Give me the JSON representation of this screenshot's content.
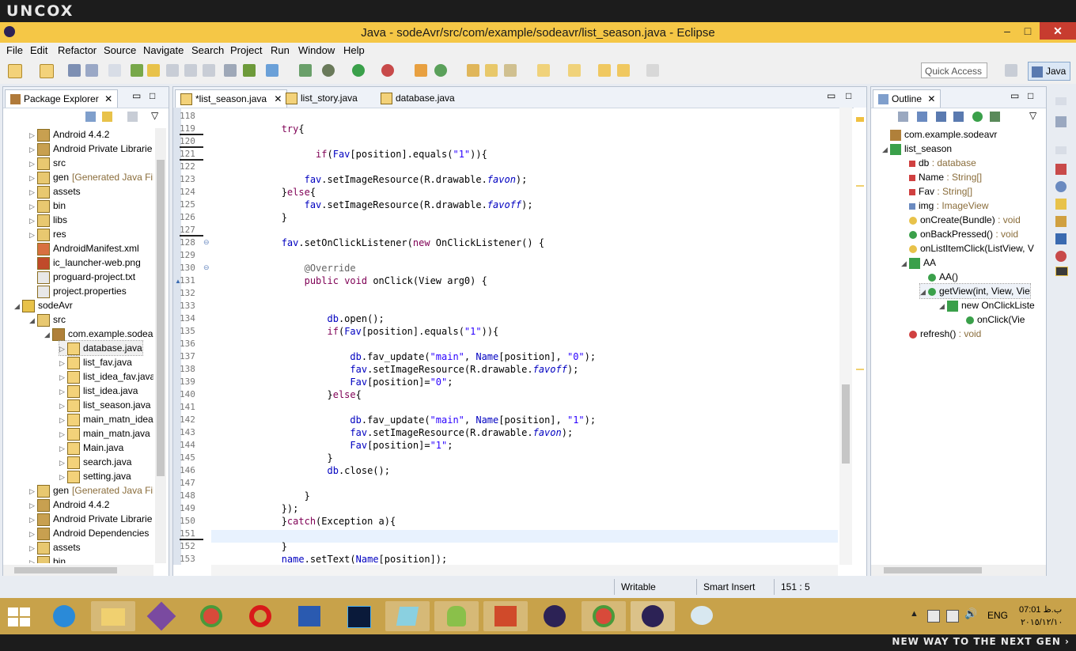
{
  "brand": "UNCOX",
  "slogan": "NEW WAY TO THE NEXT GEN ›",
  "window": {
    "title": "Java - sodeAvr/src/com/example/sodeavr/list_season.java - Eclipse",
    "min": "–",
    "max": "□",
    "close": "✕"
  },
  "menu": [
    "File",
    "Edit",
    "Refactor",
    "Source",
    "Navigate",
    "Search",
    "Project",
    "Run",
    "Window",
    "Help"
  ],
  "toolbar": {
    "quick_access": "Quick Access",
    "perspective": "Java"
  },
  "package_explorer": {
    "tab": "Package Explorer",
    "items": [
      {
        "label": "Android 4.4.2",
        "extra": "",
        "depth": 1,
        "icon": "library-icon"
      },
      {
        "label": "Android Private Librarie",
        "extra": "",
        "depth": 1,
        "icon": "library-icon"
      },
      {
        "label": "src",
        "extra": "",
        "depth": 1,
        "icon": "folder-icon"
      },
      {
        "label": "gen",
        "extra": "[Generated Java File",
        "depth": 1,
        "icon": "folder-icon"
      },
      {
        "label": "assets",
        "extra": "",
        "depth": 1,
        "icon": "folder-icon"
      },
      {
        "label": "bin",
        "extra": "",
        "depth": 1,
        "icon": "folder-icon"
      },
      {
        "label": "libs",
        "extra": "",
        "depth": 1,
        "icon": "folder-icon"
      },
      {
        "label": "res",
        "extra": "",
        "depth": 1,
        "icon": "folder-icon"
      },
      {
        "label": "AndroidManifest.xml",
        "extra": "",
        "depth": 1,
        "icon": "xml-file-icon"
      },
      {
        "label": "ic_launcher-web.png",
        "extra": "",
        "depth": 1,
        "icon": "image-file-icon"
      },
      {
        "label": "proguard-project.txt",
        "extra": "",
        "depth": 1,
        "icon": "text-file-icon"
      },
      {
        "label": "project.properties",
        "extra": "",
        "depth": 1,
        "icon": "text-file-icon"
      },
      {
        "label": "sodeAvr",
        "extra": "",
        "depth": 0,
        "icon": "project-icon"
      },
      {
        "label": "src",
        "extra": "",
        "depth": 1,
        "icon": "folder-icon"
      },
      {
        "label": "com.example.sodea",
        "extra": "",
        "depth": 2,
        "icon": "package-icon"
      },
      {
        "label": "database.java",
        "extra": "",
        "depth": 3,
        "icon": "java-file-icon"
      },
      {
        "label": "list_fav.java",
        "extra": "",
        "depth": 3,
        "icon": "java-file-icon"
      },
      {
        "label": "list_idea_fav.java",
        "extra": "",
        "depth": 3,
        "icon": "java-file-icon"
      },
      {
        "label": "list_idea.java",
        "extra": "",
        "depth": 3,
        "icon": "java-file-icon"
      },
      {
        "label": "list_season.java",
        "extra": "",
        "depth": 3,
        "icon": "java-file-icon"
      },
      {
        "label": "main_matn_idea",
        "extra": "",
        "depth": 3,
        "icon": "java-file-icon"
      },
      {
        "label": "main_matn.java",
        "extra": "",
        "depth": 3,
        "icon": "java-file-icon"
      },
      {
        "label": "Main.java",
        "extra": "",
        "depth": 3,
        "icon": "java-file-icon"
      },
      {
        "label": "search.java",
        "extra": "",
        "depth": 3,
        "icon": "java-file-icon"
      },
      {
        "label": "setting.java",
        "extra": "",
        "depth": 3,
        "icon": "java-file-icon"
      },
      {
        "label": "gen",
        "extra": "[Generated Java File",
        "depth": 1,
        "icon": "folder-icon"
      },
      {
        "label": "Android 4.4.2",
        "extra": "",
        "depth": 1,
        "icon": "library-icon"
      },
      {
        "label": "Android Private Librarie",
        "extra": "",
        "depth": 1,
        "icon": "library-icon"
      },
      {
        "label": "Android Dependencies",
        "extra": "",
        "depth": 1,
        "icon": "library-icon"
      },
      {
        "label": "assets",
        "extra": "",
        "depth": 1,
        "icon": "folder-icon"
      },
      {
        "label": "bin",
        "extra": "",
        "depth": 1,
        "icon": "folder-icon"
      }
    ]
  },
  "editor": {
    "tabs": [
      {
        "label": "*list_season.java",
        "active": true
      },
      {
        "label": "list_story.java",
        "active": false
      },
      {
        "label": "database.java",
        "active": false
      }
    ],
    "lines": [
      {
        "n": "118",
        "t": ""
      },
      {
        "n": "119",
        "t": "            try{"
      },
      {
        "n": "120",
        "t": ""
      },
      {
        "n": "121",
        "t": "                  if(Fav[position].equals(\"1\")){"
      },
      {
        "n": "122",
        "t": ""
      },
      {
        "n": "123",
        "t": "                fav.setImageResource(R.drawable.favon);"
      },
      {
        "n": "124",
        "t": "            }else{"
      },
      {
        "n": "125",
        "t": "                fav.setImageResource(R.drawable.favoff);"
      },
      {
        "n": "126",
        "t": "            }"
      },
      {
        "n": "127",
        "t": ""
      },
      {
        "n": "128",
        "t": "            fav.setOnClickListener(new OnClickListener() {"
      },
      {
        "n": "129",
        "t": ""
      },
      {
        "n": "130",
        "t": "                @Override"
      },
      {
        "n": "131",
        "t": "                public void onClick(View arg0) {"
      },
      {
        "n": "132",
        "t": ""
      },
      {
        "n": "133",
        "t": ""
      },
      {
        "n": "134",
        "t": "                    db.open();"
      },
      {
        "n": "135",
        "t": "                    if(Fav[position].equals(\"1\")){"
      },
      {
        "n": "136",
        "t": ""
      },
      {
        "n": "137",
        "t": "                        db.fav_update(\"main\", Name[position], \"0\");"
      },
      {
        "n": "138",
        "t": "                        fav.setImageResource(R.drawable.favoff);"
      },
      {
        "n": "139",
        "t": "                        Fav[position]=\"0\";"
      },
      {
        "n": "140",
        "t": "                    }else{"
      },
      {
        "n": "141",
        "t": ""
      },
      {
        "n": "142",
        "t": "                        db.fav_update(\"main\", Name[position], \"1\");"
      },
      {
        "n": "143",
        "t": "                        fav.setImageResource(R.drawable.favon);"
      },
      {
        "n": "144",
        "t": "                        Fav[position]=\"1\";"
      },
      {
        "n": "145",
        "t": "                    }"
      },
      {
        "n": "146",
        "t": "                    db.close();"
      },
      {
        "n": "147",
        "t": ""
      },
      {
        "n": "148",
        "t": "                }"
      },
      {
        "n": "149",
        "t": "            });"
      },
      {
        "n": "150",
        "t": "            }catch(Exception a){"
      },
      {
        "n": "151",
        "t": ""
      },
      {
        "n": "152",
        "t": "            }"
      },
      {
        "n": "153",
        "t": "            name.setText(Name[position]);"
      }
    ]
  },
  "outline": {
    "tab": "Outline",
    "items": [
      {
        "label": "com.example.sodeavr",
        "type": "",
        "depth": 0,
        "icon": "package-icon"
      },
      {
        "label": "list_season",
        "type": "",
        "depth": 0,
        "icon": "class-icon"
      },
      {
        "label": "db",
        "type": " : database",
        "depth": 1,
        "icon": "private-field-icon"
      },
      {
        "label": "Name",
        "type": " : String[]",
        "depth": 1,
        "icon": "private-field-icon"
      },
      {
        "label": "Fav",
        "type": " : String[]",
        "depth": 1,
        "icon": "private-field-icon"
      },
      {
        "label": "img",
        "type": " : ImageView",
        "depth": 1,
        "icon": "field-icon"
      },
      {
        "label": "onCreate(Bundle)",
        "type": " : void",
        "depth": 1,
        "icon": "protected-method-icon"
      },
      {
        "label": "onBackPressed()",
        "type": " : void",
        "depth": 1,
        "icon": "public-method-icon"
      },
      {
        "label": "onListItemClick(ListView, V",
        "type": "",
        "depth": 1,
        "icon": "protected-method-icon"
      },
      {
        "label": "AA",
        "type": "",
        "depth": 1,
        "icon": "inner-class-icon"
      },
      {
        "label": "AA()",
        "type": "",
        "depth": 2,
        "icon": "constructor-icon"
      },
      {
        "label": "getView(int, View, Vie",
        "type": "",
        "depth": 2,
        "icon": "public-method-icon"
      },
      {
        "label": "new OnClickListe",
        "type": "",
        "depth": 3,
        "icon": "anonymous-class-icon"
      },
      {
        "label": "onClick(Vie",
        "type": "",
        "depth": 4,
        "icon": "public-method-icon"
      },
      {
        "label": "refresh()",
        "type": " : void",
        "depth": 1,
        "icon": "private-method-icon"
      }
    ]
  },
  "status": {
    "writable": "Writable",
    "insert": "Smart Insert",
    "position": "151 : 5"
  },
  "tray": {
    "lang": "ENG",
    "time": "07:01 ب.ظ",
    "date": "٢٠١٥/١٢/١٠"
  },
  "colors": {
    "titlebar": "#f5c746",
    "taskbar": "#c8a24a",
    "close": "#c73c2f",
    "keyword": "#7f0055",
    "string": "#2a00ff",
    "field": "#0000c0"
  }
}
